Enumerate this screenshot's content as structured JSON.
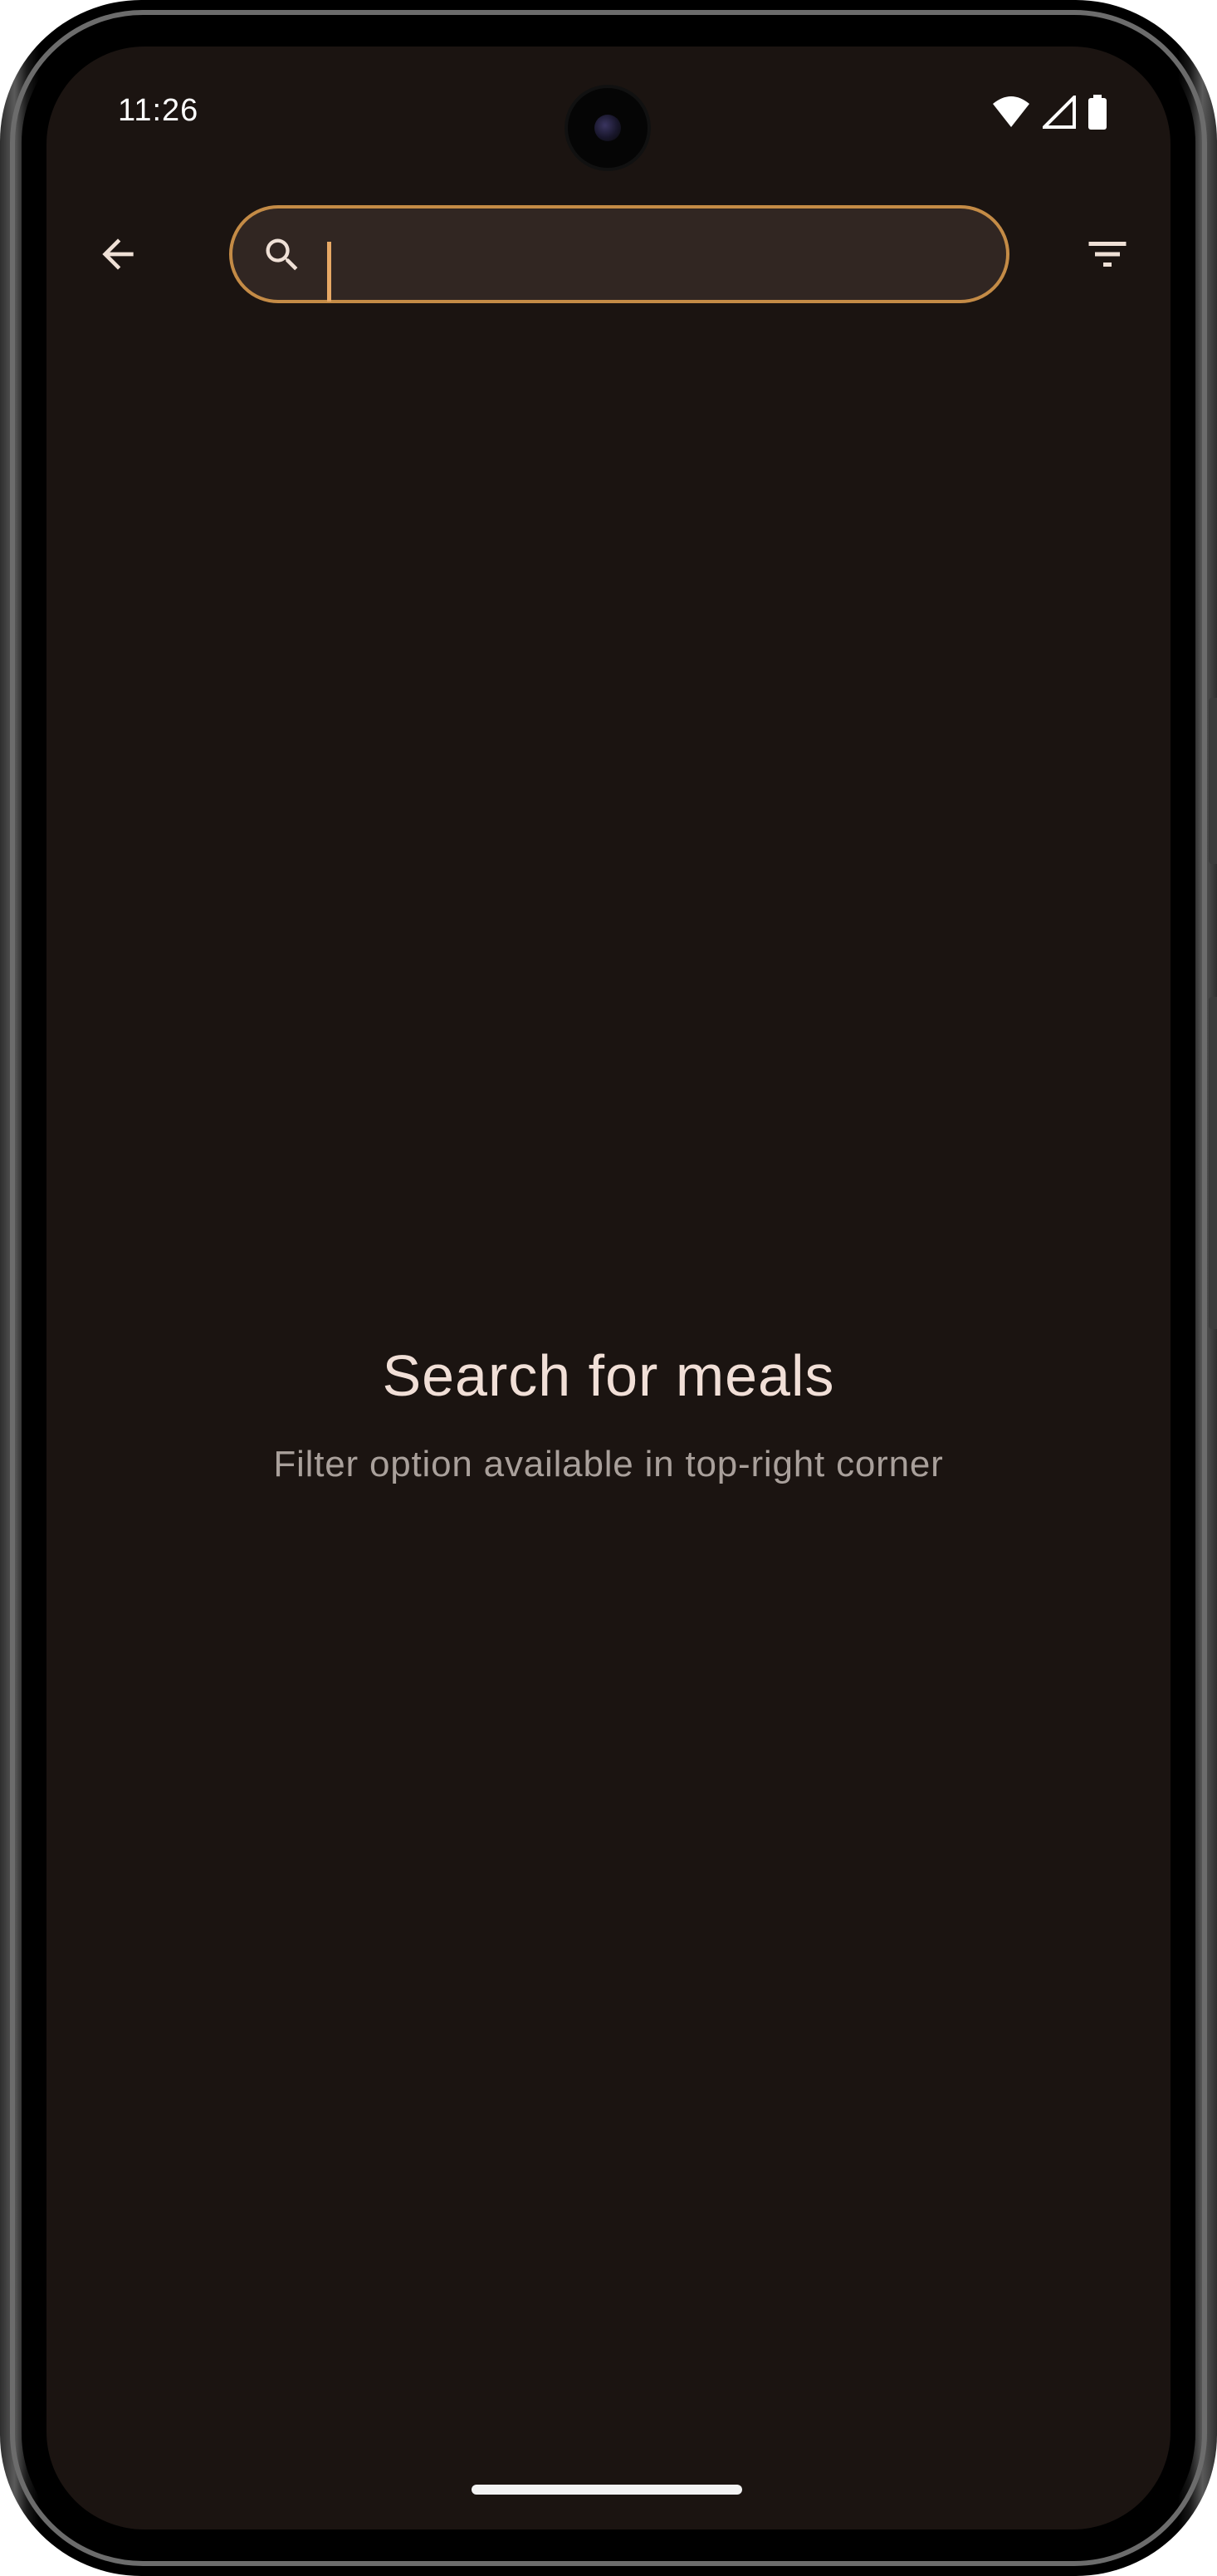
{
  "status_bar": {
    "time": "11:26",
    "icons": [
      "wifi-icon",
      "signal-icon",
      "battery-icon"
    ]
  },
  "app_bar": {
    "back_icon": "arrow-back-icon",
    "search": {
      "value": "",
      "placeholder": "",
      "icon": "search-icon"
    },
    "filter_icon": "filter-icon"
  },
  "empty_state": {
    "title": "Search for meals",
    "subtitle": "Filter option available in top-right corner"
  },
  "colors": {
    "background": "#1b1411",
    "search_fill": "#312622",
    "accent": "#c48b46",
    "title_text": "#f1dfd7",
    "subtitle_text": "#a9a09b"
  }
}
